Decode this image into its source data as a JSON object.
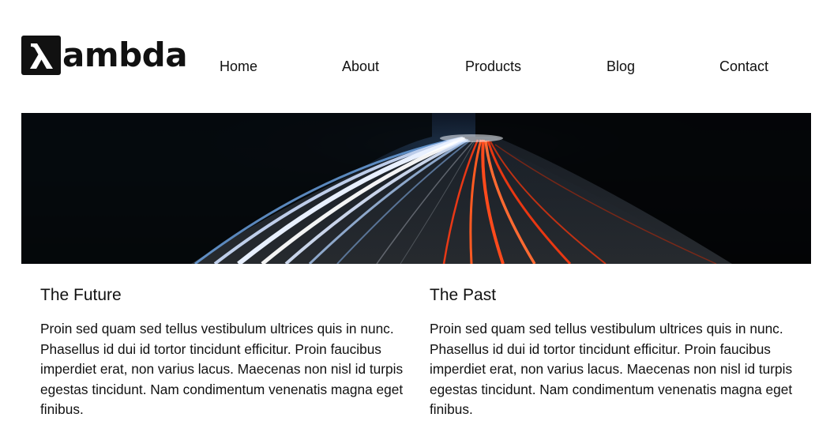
{
  "brand": {
    "mark_glyph": "λ",
    "name": "ambda"
  },
  "nav": {
    "items": [
      {
        "label": "Home"
      },
      {
        "label": "About"
      },
      {
        "label": "Products"
      },
      {
        "label": "Blog"
      },
      {
        "label": "Contact"
      }
    ]
  },
  "hero": {
    "image": "night-highway-light-trails"
  },
  "columns": [
    {
      "title": "The Future",
      "body": "Proin sed quam sed tellus vestibulum ultrices quis in nunc. Phasellus id dui id tortor tincidunt efficitur. Proin faucibus imperdiet erat, non varius lacus. Maecenas non nisl id turpis egestas tincidunt. Nam condimentum venenatis magna eget finibus."
    },
    {
      "title": "The Past",
      "body": "Proin sed quam sed tellus vestibulum ultrices quis in nunc. Phasellus id dui id tortor tincidunt efficitur. Proin faucibus imperdiet erat, non varius lacus. Maecenas non nisl id turpis egestas tincidunt. Nam condimentum venenatis magna eget finibus."
    }
  ],
  "colors": {
    "text": "#111111",
    "background": "#ffffff",
    "trail_white": "#e8f0ff",
    "trail_blue": "#6fa8e8",
    "trail_red": "#ff4a1c"
  }
}
